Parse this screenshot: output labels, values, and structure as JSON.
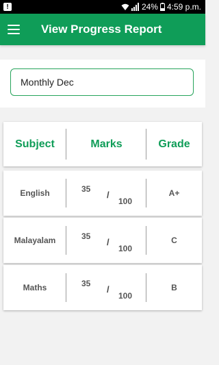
{
  "status_bar": {
    "battery": "24%",
    "time": "4:59 p.m.",
    "notification_icon": "notification-icon",
    "wifi_icon": "wifi-icon",
    "signal_icon": "signal-icon",
    "battery_icon": "battery-icon"
  },
  "toolbar": {
    "title": "View Progress Report",
    "menu_icon": "menu-icon",
    "color": "#0f9d58"
  },
  "period_select": {
    "value": "Monthly Dec"
  },
  "table": {
    "headers": [
      "Subject",
      "Marks",
      "Grade"
    ],
    "rows": [
      {
        "subject": "English",
        "obtained": "35",
        "separator": "/",
        "total": "100",
        "grade": "A+"
      },
      {
        "subject": "Malayalam",
        "obtained": "35",
        "separator": "/",
        "total": "100",
        "grade": "C"
      },
      {
        "subject": "Maths",
        "obtained": "35",
        "separator": "/",
        "total": "100",
        "grade": "B"
      }
    ]
  }
}
